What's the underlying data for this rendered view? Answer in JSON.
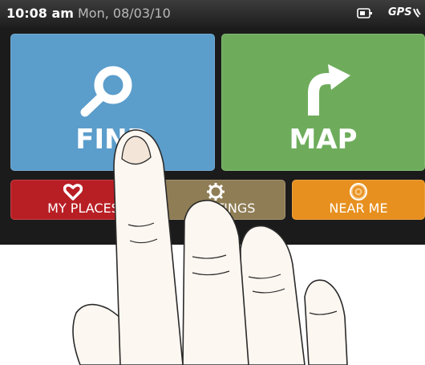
{
  "status_bar": {
    "time": "10:08 am",
    "date": "Mon, 08/03/10",
    "gps": "GPS",
    "icons": [
      "battery-icon",
      "gps-signal-icon"
    ]
  },
  "tiles": {
    "find": {
      "label": "FIND",
      "icon": "search-icon",
      "color": "#5b9dcb"
    },
    "map": {
      "label": "MAP",
      "icon": "turn-arrow-icon",
      "color": "#6eac5c"
    },
    "my_places": {
      "label": "MY PLACES",
      "icon": "heart-icon",
      "color": "#b81f25"
    },
    "settings": {
      "label": "SETTINGS",
      "icon": "gear-icon",
      "color": "#8f7d55"
    },
    "near_me": {
      "label": "NEAR ME",
      "icon": "location-target-icon",
      "color": "#e7901f"
    }
  }
}
